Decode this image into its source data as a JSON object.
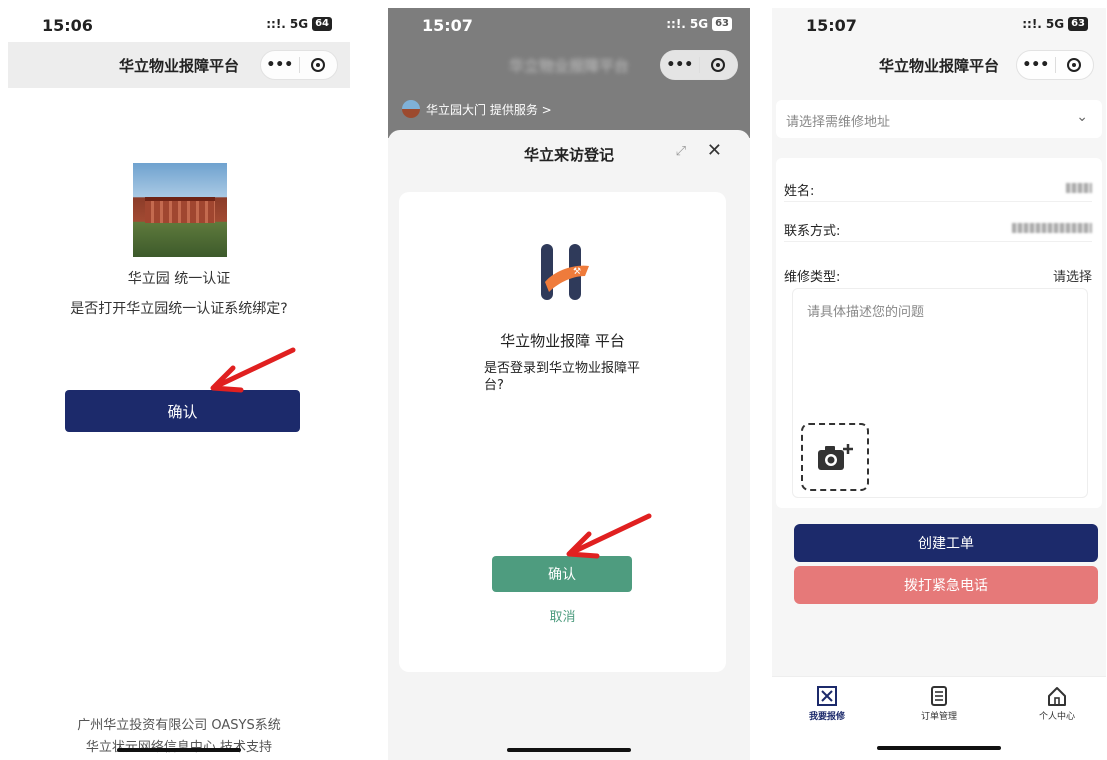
{
  "phone1": {
    "status": {
      "time": "15:06",
      "network": "5G",
      "battery": "64"
    },
    "navbar": {
      "title": "华立物业报障平台",
      "more_icon": "ellipsis-icon",
      "close_icon": "record-icon"
    },
    "app_name": "华立园 统一认证",
    "question": "是否打开华立园统一认证系统绑定?",
    "confirm_label": "确认",
    "footer": {
      "line1": "广州华立投资有限公司 OASYS系统",
      "line2": "华立状元网络信息中心 技术支持"
    }
  },
  "phone2": {
    "status": {
      "time": "15:07",
      "network": "5G",
      "battery": "63"
    },
    "navbar": {
      "title": "华立物业报障平台"
    },
    "provider": "华立园大门 提供服务 >",
    "sheet": {
      "title": "华立来访登记",
      "app_title": "华立物业报障 平台",
      "question": "是否登录到华立物业报障平台?",
      "confirm_label": "确认",
      "cancel_label": "取消"
    }
  },
  "phone3": {
    "status": {
      "time": "15:07",
      "network": "5G",
      "battery": "63"
    },
    "navbar": {
      "title": "华立物业报障平台"
    },
    "address_placeholder": "请选择需维修地址",
    "form": {
      "name_label": "姓名:",
      "contact_label": "联系方式:",
      "repair_type_label": "维修类型:",
      "repair_type_value": "请选择",
      "description_placeholder": "请具体描述您的问题"
    },
    "create_label": "创建工单",
    "emergency_label": "拨打紧急电话",
    "tabs": [
      {
        "label": "我要报修",
        "icon": "repair-icon",
        "active": true
      },
      {
        "label": "订单管理",
        "icon": "document-icon",
        "active": false
      },
      {
        "label": "个人中心",
        "icon": "home-icon",
        "active": false
      }
    ]
  },
  "colors": {
    "navy": "#1c2a6b",
    "green": "#4e9c7f",
    "emergency": "#e67979",
    "annotation": "#e02020"
  }
}
